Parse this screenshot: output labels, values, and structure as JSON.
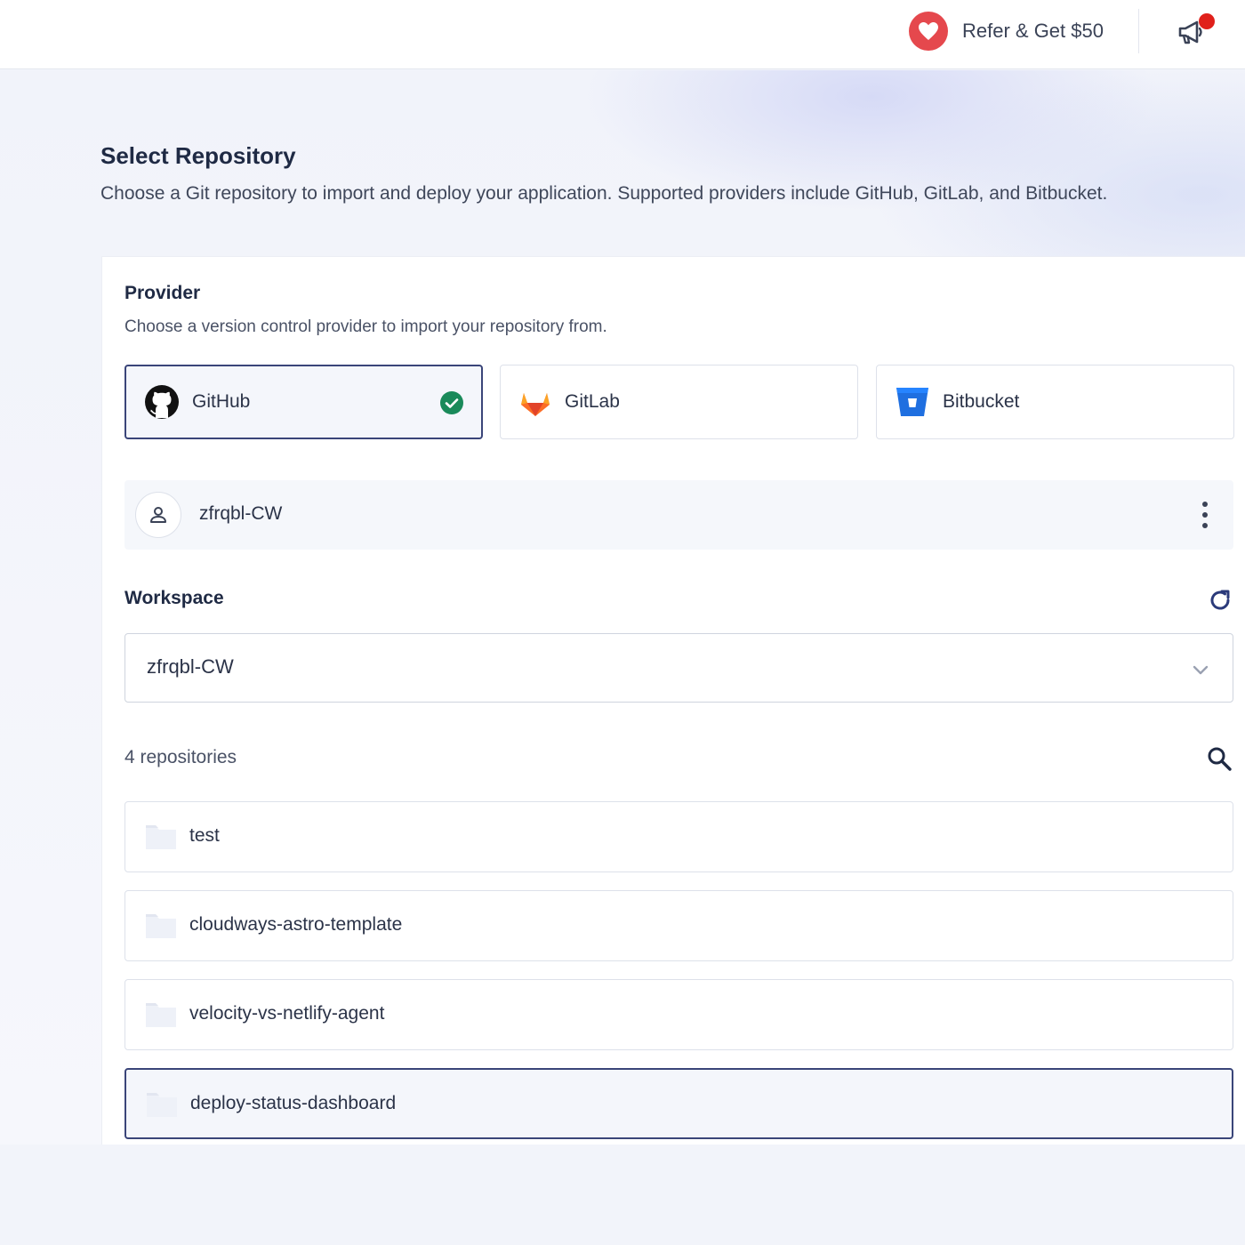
{
  "header": {
    "refer_label": "Refer & Get $50",
    "heart_icon": "heart-icon",
    "announcement_icon": "megaphone-icon",
    "notification_color": "#e0201b"
  },
  "page": {
    "title": "Select Repository",
    "subtitle": "Choose a Git repository to import and deploy your application. Supported providers include GitHub, GitLab, and Bitbucket."
  },
  "provider_section": {
    "title": "Provider",
    "description": "Choose a version control provider to import your repository from.",
    "providers": [
      {
        "label": "GitHub",
        "icon": "github-icon",
        "selected": true
      },
      {
        "label": "GitLab",
        "icon": "gitlab-icon",
        "selected": false
      },
      {
        "label": "Bitbucket",
        "icon": "bitbucket-icon",
        "selected": false
      }
    ]
  },
  "account": {
    "name": "zfrqbl-CW"
  },
  "workspace": {
    "title": "Workspace",
    "selected": "zfrqbl-CW"
  },
  "repositories": {
    "count_label": "4 repositories",
    "items": [
      {
        "name": "test",
        "selected": false
      },
      {
        "name": "cloudways-astro-template",
        "selected": false
      },
      {
        "name": "velocity-vs-netlify-agent",
        "selected": false
      },
      {
        "name": "deploy-status-dashboard",
        "selected": true
      }
    ]
  },
  "colors": {
    "accent": "#3a4579",
    "check_green": "#1a8a5a",
    "heart_red": "#e5484d"
  }
}
